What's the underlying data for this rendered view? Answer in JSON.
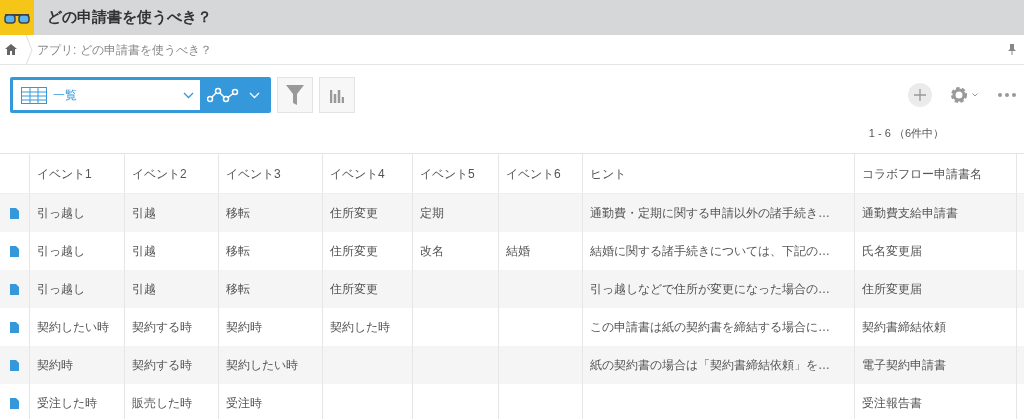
{
  "app_bar": {
    "title": "どの申請書を使うべき？"
  },
  "breadcrumb": {
    "items": [
      "アプリ: どの申請書を使うべき？"
    ]
  },
  "view_selector": {
    "value": "一覧"
  },
  "record_count": "1 - 6 （6件中）",
  "table": {
    "columns": [
      "イベント1",
      "イベント2",
      "イベント3",
      "イベント4",
      "イベント5",
      "イベント6",
      "ヒント",
      "コラボフロー申請書名"
    ],
    "rows": [
      [
        "引っ越し",
        "引越",
        "移転",
        "住所変更",
        "定期",
        "",
        "通勤費・定期に関する申請以外の諸手続き…",
        "通勤費支給申請書"
      ],
      [
        "引っ越し",
        "引越",
        "移転",
        "住所変更",
        "改名",
        "結婚",
        "結婚に関する諸手続きについては、下記の…",
        "氏名変更届"
      ],
      [
        "引っ越し",
        "引越",
        "移転",
        "住所変更",
        "",
        "",
        "引っ越しなどで住所が変更になった場合の…",
        "住所変更届"
      ],
      [
        "契約したい時",
        "契約する時",
        "契約時",
        "契約した時",
        "",
        "",
        "この申請書は紙の契約書を締結する場合に…",
        "契約書締結依頼"
      ],
      [
        "契約時",
        "契約する時",
        "契約したい時",
        "",
        "",
        "",
        "紙の契約書の場合は「契約書締結依頼」を…",
        "電子契約申請書"
      ],
      [
        "受注した時",
        "販売した時",
        "受注時",
        "",
        "",
        "",
        "",
        "受注報告書"
      ]
    ]
  }
}
